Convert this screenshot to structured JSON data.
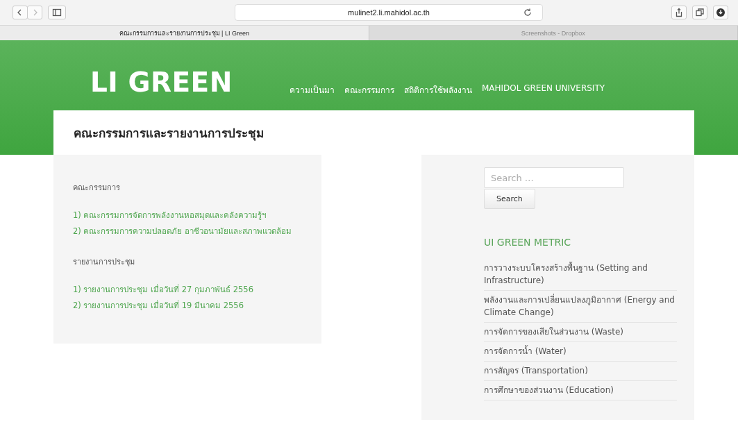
{
  "browser": {
    "url": "mulinet2.li.mahidol.ac.th",
    "tabs": [
      {
        "label": "คณะกรรมการและรายงานการประชุม |  LI Green",
        "selected": true
      },
      {
        "label": "Screenshots - Dropbox",
        "selected": false
      }
    ]
  },
  "site": {
    "logo": "LI GREEN",
    "nav": [
      "ความเป็นมา",
      "คณะกรรมการ",
      "สถิติการใช้พลังงาน",
      "MAHIDOL GREEN UNIVERSITY"
    ]
  },
  "page_title": "คณะกรรมการและรายงานการประชุม",
  "content": [
    {
      "kind": "heading",
      "text": "คณะกรรมการ"
    },
    {
      "kind": "links",
      "items": [
        "1) คณะกรรมการจัดการพลังงานหอสมุดและคลังความรู้ฯ",
        "2) คณะกรรมการความปลอดภัย อาชีวอนามัยและสภาพแวดล้อม"
      ]
    },
    {
      "kind": "heading",
      "text": "รายงานการประชุม"
    },
    {
      "kind": "links",
      "items": [
        "1) รายงานการประชุม เมื่อวันที่ 27 กุมภาพันธ์ 2556",
        "2) รายงานการประชุม เมื่อวันที่ 19 มีนาคม 2556"
      ]
    }
  ],
  "sidebar": {
    "search": {
      "placeholder": "Search …",
      "button": "Search"
    },
    "widget_title": "UI GREEN METRIC",
    "items": [
      "การวางระบบโครงสร้างพื้นฐาน (Setting and Infrastructure)",
      "พลังงานและการเปลี่ยนแปลงภูมิอากาศ (Energy and Climate Change)",
      "การจัดการของเสียในส่วนงาน (Waste)",
      "การจัดการน้ำ (Water)",
      "การสัญจร (Transportation)",
      "การศึกษาของส่วนงาน (Education)"
    ]
  }
}
